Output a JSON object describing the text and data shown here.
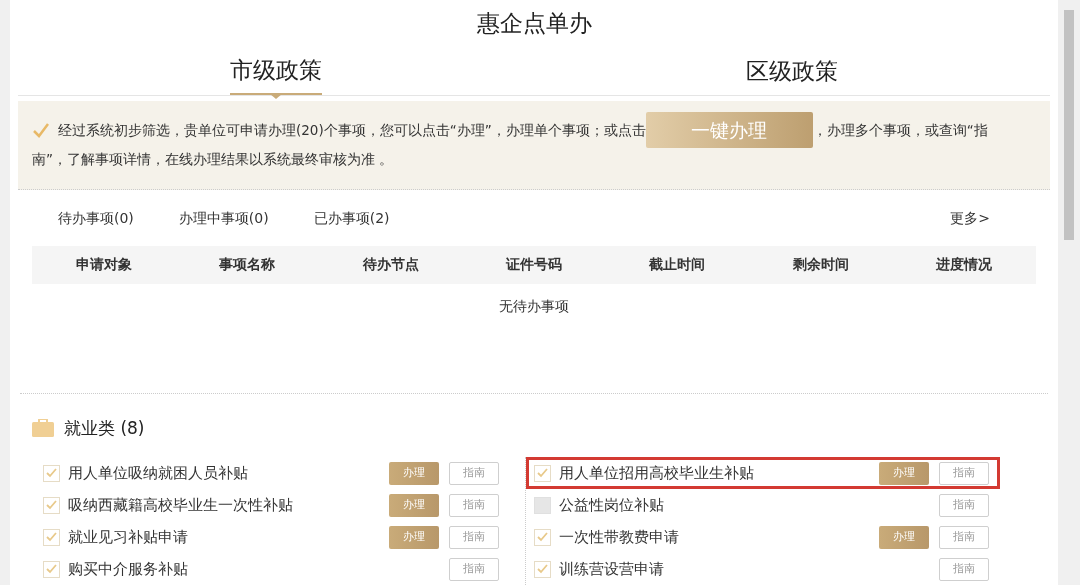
{
  "title": "惠企点单办",
  "policy_tabs": [
    {
      "label": "市级政策",
      "selected": true
    },
    {
      "label": "区级政策",
      "selected": false
    }
  ],
  "notice": {
    "text_before": "经过系统初步筛选，贵单位可申请办理(20)个事项，您可以点击“办理”，办理单个事项；或点击",
    "button": "一键办理",
    "text_after_lines": [
      "，办理多个事项，或查询“指",
      "南”，了解事项详情，在线办理结果以系统最终审核为准 。"
    ]
  },
  "task_tabs": [
    "待办事项(0)",
    "办理中事项(0)",
    "已办事项(2)"
  ],
  "more_link": "更多>",
  "table": {
    "columns": [
      "申请对象",
      "事项名称",
      "待办节点",
      "证件号码",
      "截止时间",
      "剩余时间",
      "进度情况"
    ],
    "empty_text": "无待办事项"
  },
  "category": {
    "title": "就业类 (8)"
  },
  "items": [
    {
      "label": "用人单位吸纳就困人员补贴",
      "checked": true,
      "action": "办理",
      "guide": "指南",
      "highlighted": false
    },
    {
      "label": "用人单位招用高校毕业生补贴",
      "checked": true,
      "action": "办理",
      "guide": "指南",
      "highlighted": true
    },
    {
      "label": "吸纳西藏籍高校毕业生一次性补贴",
      "checked": true,
      "action": "办理",
      "guide": "指南",
      "highlighted": false
    },
    {
      "label": "公益性岗位补贴",
      "checked": false,
      "guide": "指南",
      "highlighted": false
    },
    {
      "label": "就业见习补贴申请",
      "checked": true,
      "action": "办理",
      "guide": "指南",
      "highlighted": false
    },
    {
      "label": "一次性带教费申请",
      "checked": true,
      "action": "办理",
      "guide": "指南",
      "highlighted": false
    },
    {
      "label": "购买中介服务补贴",
      "checked": true,
      "guide": "指南",
      "highlighted": false
    },
    {
      "label": "训练营设营申请",
      "checked": true,
      "guide": "指南",
      "highlighted": false
    }
  ]
}
